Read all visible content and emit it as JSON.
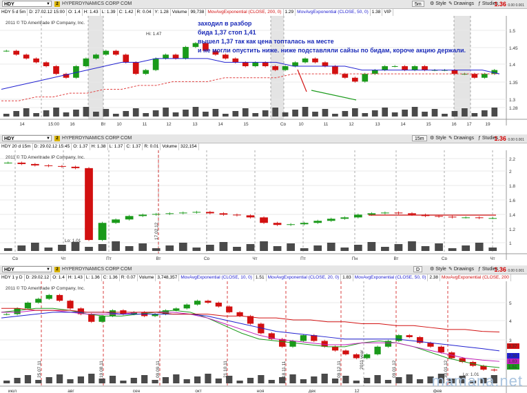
{
  "panels": [
    {
      "symbol": "HDY",
      "company": "HYPERDYNAMICS CORP COM",
      "timeframe": "5m",
      "price": "1.36",
      "tick": "0.00 0.001",
      "status": [
        "HDY 5 d 5m",
        "D: 27.02.12 15:00",
        "O: 1.4",
        "H: 1.43",
        "L: 1.39",
        "C: 1.42",
        "R: 0.04",
        "Y: 1.28",
        "Volume",
        "99,738",
        "MovAvgExponential (CLOSE, 200, 0)",
        "1.29",
        "MovAvgExponential (CLOSE, 50, 0)",
        "1.38",
        "VIP"
      ],
      "copyright": "2011 © TD Ameritrade IP Company, Inc.",
      "hi_label": "Hi: 1.47",
      "y_ticks": [
        "1.5",
        "1.45",
        "1.4",
        "1.35",
        "1.3",
        "1.28"
      ],
      "x_ticks": [
        "14",
        "15:00",
        "16",
        "Вт",
        "10",
        "11",
        "12",
        "13",
        "14",
        "15",
        "Ср",
        "10",
        "11",
        "12",
        "13",
        "14",
        "15",
        "16",
        "17",
        "19"
      ]
    },
    {
      "symbol": "HDY",
      "company": "HYPERDYNAMICS CORP COM",
      "timeframe": "15m",
      "price": "1.36",
      "tick": "0.00 0.001",
      "status": [
        "HDY 20 d 15m",
        "D: 29.02.12 15:45",
        "O: 1.37",
        "H: 1.38",
        "L: 1.37",
        "C: 1.37",
        "R: 0.01",
        "Volume",
        "322,154"
      ],
      "copyright": "2011 © TD Ameritrade IP Company, Inc.",
      "lo_label": "Lo: 1.01",
      "date_marker": "17.02.12",
      "y_ticks": [
        "2.2",
        "2",
        "1.8",
        "1.6",
        "1.4",
        "1.2",
        "1"
      ],
      "x_ticks": [
        "Ср",
        "Чт",
        "Пт",
        "Вт",
        "Ср",
        "Чт",
        "Пт",
        "Пн",
        "Вт",
        "Ср",
        "Чт"
      ]
    },
    {
      "symbol": "HDY",
      "company": "HYPERDYNAMICS CORP COM",
      "timeframe": "D",
      "price": "1.36",
      "tick": "0.00 0.001",
      "status": [
        "HDY 1 y D",
        "D: 29.02.12",
        "O: 1.4",
        "H: 1.43",
        "L: 1.36",
        "C: 1.36",
        "R: 0.07",
        "Volume",
        "3,748,357",
        "MovAvgExponential (CLOSE, 10, 0)",
        "1.51",
        "MovAvgExponential (CLOSE, 20, 0)",
        "1.83",
        "MovAvgExponential (CLOSE, 50, 0)",
        "2.38",
        "MovAvgExponential (CLOSE, 200"
      ],
      "copyright": "2011 © TD Ameritrade IP Company, Inc.",
      "lo_label": "Lo: 1.01",
      "year_marker": "2011 year",
      "date_markers": [
        "25.07.11",
        "19.08.11",
        "09.09.11",
        "21.10.11",
        "18.11.11",
        "09.12.11",
        "09.01.12",
        "30.01.12"
      ],
      "y_ticks": [
        "5",
        "4",
        "3",
        "2"
      ],
      "price_tags": [
        "3.37",
        "2.38",
        "1.83",
        "1.51"
      ],
      "x_ticks": [
        "июл",
        "авг",
        "сен",
        "окт",
        "ноя",
        "дек",
        "12",
        "фев"
      ]
    }
  ],
  "annotation": {
    "lines": [
      "заходил в разбор",
      "бида 1,37 стоп 1,41",
      "вышел 1,37 так как цена топталась на месте",
      "и не могли опустить ниже. ниже подставляли сайзы по бидам, короче акцию держали."
    ]
  },
  "toolbar": {
    "style": "Style",
    "drawings": "Drawings",
    "studies": "Studies"
  },
  "watermark": "mamana.net",
  "colors": {
    "up": "#1a9a1a",
    "down": "#d21010",
    "ema200": "#e04040",
    "ema50": "#2020d0",
    "volume": "#555555",
    "annotation": "#1a2ab8"
  },
  "chart_data": [
    {
      "type": "candlestick",
      "title": "HDY 5 d 5m",
      "ylim": [
        1.28,
        1.52
      ],
      "series": [
        {
          "name": "HDY",
          "values": [
            1.44,
            1.43,
            1.42,
            1.41,
            1.4,
            1.38,
            1.37,
            1.4,
            1.42,
            1.43,
            1.44,
            1.43,
            1.41,
            1.38,
            1.39,
            1.42,
            1.43,
            1.42,
            1.45,
            1.46,
            1.44,
            1.43,
            1.42,
            1.41,
            1.4,
            1.41,
            1.4,
            1.39,
            1.4,
            1.41,
            1.42,
            1.41,
            1.4,
            1.38,
            1.37,
            1.36,
            1.38,
            1.39,
            1.4,
            1.4,
            1.39,
            1.4,
            1.39,
            1.39,
            1.39,
            1.38,
            1.38,
            1.37,
            1.38,
            1.39
          ]
        },
        {
          "name": "MovAvgExponential (CLOSE, 200, 0)",
          "values": [
            1.31,
            1.31,
            1.32,
            1.32,
            1.33,
            1.33,
            1.34,
            1.34,
            1.35,
            1.35,
            1.36,
            1.36,
            1.36,
            1.37,
            1.37,
            1.37,
            1.37,
            1.38,
            1.38,
            1.38,
            1.38,
            1.38,
            1.38,
            1.38,
            1.38,
            1.38,
            1.38,
            1.38,
            1.38,
            1.38
          ]
        },
        {
          "name": "MovAvgExponential (CLOSE, 50, 0)",
          "values": [
            1.34,
            1.35,
            1.36,
            1.37,
            1.38,
            1.39,
            1.4,
            1.41,
            1.41,
            1.42,
            1.42,
            1.42,
            1.42,
            1.41,
            1.41,
            1.41,
            1.41,
            1.4,
            1.4,
            1.4,
            1.4,
            1.39,
            1.39,
            1.39,
            1.39,
            1.39,
            1.39,
            1.39,
            1.39,
            1.38
          ]
        }
      ]
    },
    {
      "type": "candlestick",
      "title": "HDY 20 d 15m",
      "ylim": [
        0.95,
        2.3
      ],
      "series": [
        {
          "name": "HDY",
          "values": [
            2.18,
            2.16,
            2.14,
            2.13,
            2.12,
            2.1,
            1.05,
            1.3,
            1.35,
            1.4,
            1.42,
            1.43,
            1.44,
            1.45,
            1.46,
            1.44,
            1.42,
            1.41,
            1.38,
            1.3,
            1.27,
            1.28,
            1.3,
            1.33,
            1.36,
            1.38,
            1.42,
            1.44,
            1.45,
            1.44,
            1.42,
            1.4,
            1.39,
            1.38,
            1.38,
            1.37,
            1.37
          ]
        }
      ]
    },
    {
      "type": "candlestick",
      "title": "HDY 1 y D",
      "ylim": [
        0.9,
        5.8
      ],
      "series": [
        {
          "name": "HDY",
          "values": [
            4.3,
            4.6,
            4.9,
            5.1,
            5.3,
            5.0,
            4.6,
            4.3,
            3.9,
            4.2,
            4.5,
            4.3,
            4.4,
            4.2,
            4.3,
            4.5,
            4.6,
            4.8,
            5.0,
            4.9,
            4.7,
            4.4,
            4.2,
            3.8,
            3.3,
            3.0,
            2.6,
            2.9,
            3.2,
            2.9,
            2.6,
            2.4,
            2.2,
            2.0,
            2.2,
            2.6,
            2.9,
            3.2,
            3.1,
            2.8,
            2.6,
            2.3,
            2.0,
            1.8,
            1.6,
            1.4,
            1.36
          ]
        },
        {
          "name": "MovAvgExponential (CLOSE, 10, 0)",
          "values": [
            1.51
          ]
        },
        {
          "name": "MovAvgExponential (CLOSE, 20, 0)",
          "values": [
            1.83
          ]
        },
        {
          "name": "MovAvgExponential (CLOSE, 50, 0)",
          "values": [
            2.38
          ]
        }
      ]
    }
  ]
}
